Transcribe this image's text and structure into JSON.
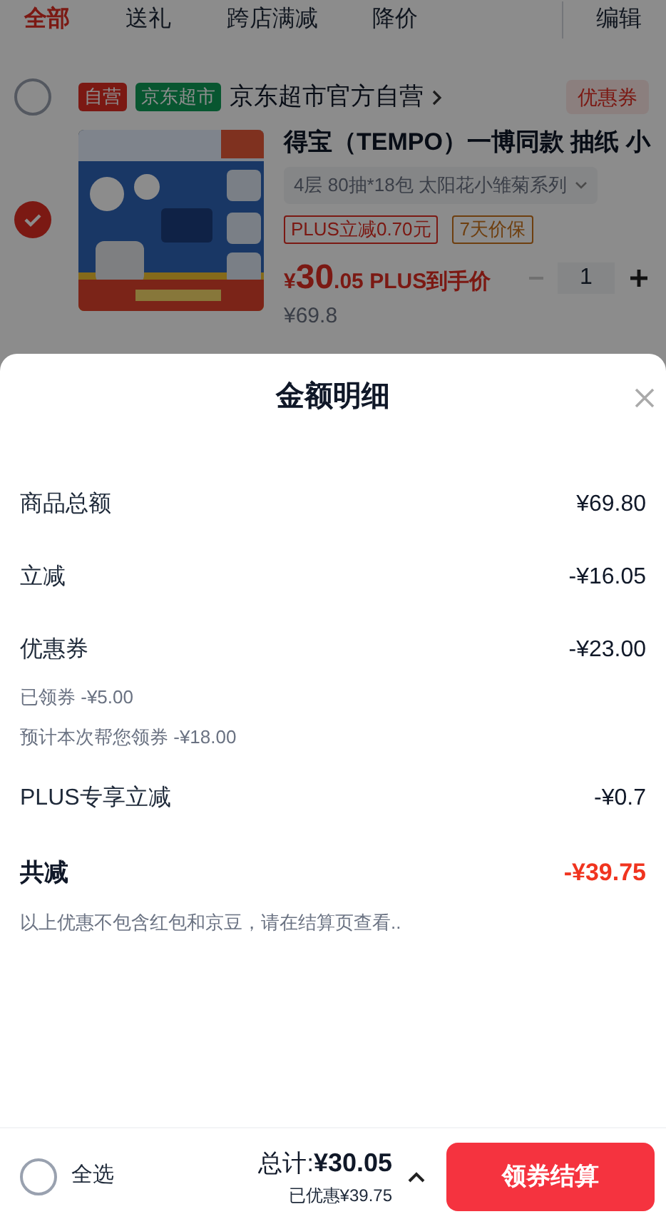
{
  "tabs": [
    {
      "label": "全部",
      "selected": true
    },
    {
      "label": "送礼",
      "selected": false
    },
    {
      "label": "跨店满减",
      "selected": false
    },
    {
      "label": "降价",
      "selected": false
    }
  ],
  "edit_label": "编辑",
  "store": {
    "checked": false,
    "badges": [
      {
        "label": "自营",
        "kind": "self"
      },
      {
        "label": "京东超市",
        "kind": "channel"
      }
    ],
    "name": "京东超市官方自营",
    "coupon": "优惠券"
  },
  "product": {
    "checked": true,
    "title": "得宝（TEMPO）一博同款 抽纸 小",
    "spec": "4层 80抽*18包 太阳花小雏菊系列",
    "tags": [
      {
        "label": "PLUS立减0.70元",
        "kind": "plus"
      },
      {
        "label": "7天价保",
        "kind": "guarantee"
      }
    ],
    "price_symbol": "¥",
    "price_int": "30",
    "price_dec": ".05",
    "price_note": "PLUS到手价",
    "original_price": "¥69.8",
    "quantity": "1"
  },
  "sheet": {
    "title": "金额明细",
    "rows": [
      {
        "kind": "item",
        "label": "商品总额",
        "value": "¥69.80"
      },
      {
        "kind": "item",
        "label": "立减",
        "value": "-¥16.05"
      },
      {
        "kind": "item",
        "label": "优惠券",
        "value": "-¥23.00",
        "notes": [
          "已领券 -¥5.00",
          "预计本次帮您领券 -¥18.00"
        ]
      },
      {
        "kind": "item",
        "label": "PLUS专享立减",
        "value": "-¥0.7"
      },
      {
        "kind": "total",
        "label": "共减",
        "value": "-¥39.75"
      }
    ],
    "footnote": "以上优惠不包含红包和京豆，请在结算页查看.."
  },
  "bottom": {
    "select_all": {
      "label": "全选",
      "checked": false
    },
    "total_label": "总计:",
    "total": "¥30.05",
    "saved": "已优惠¥39.75",
    "button": "领券结算"
  }
}
